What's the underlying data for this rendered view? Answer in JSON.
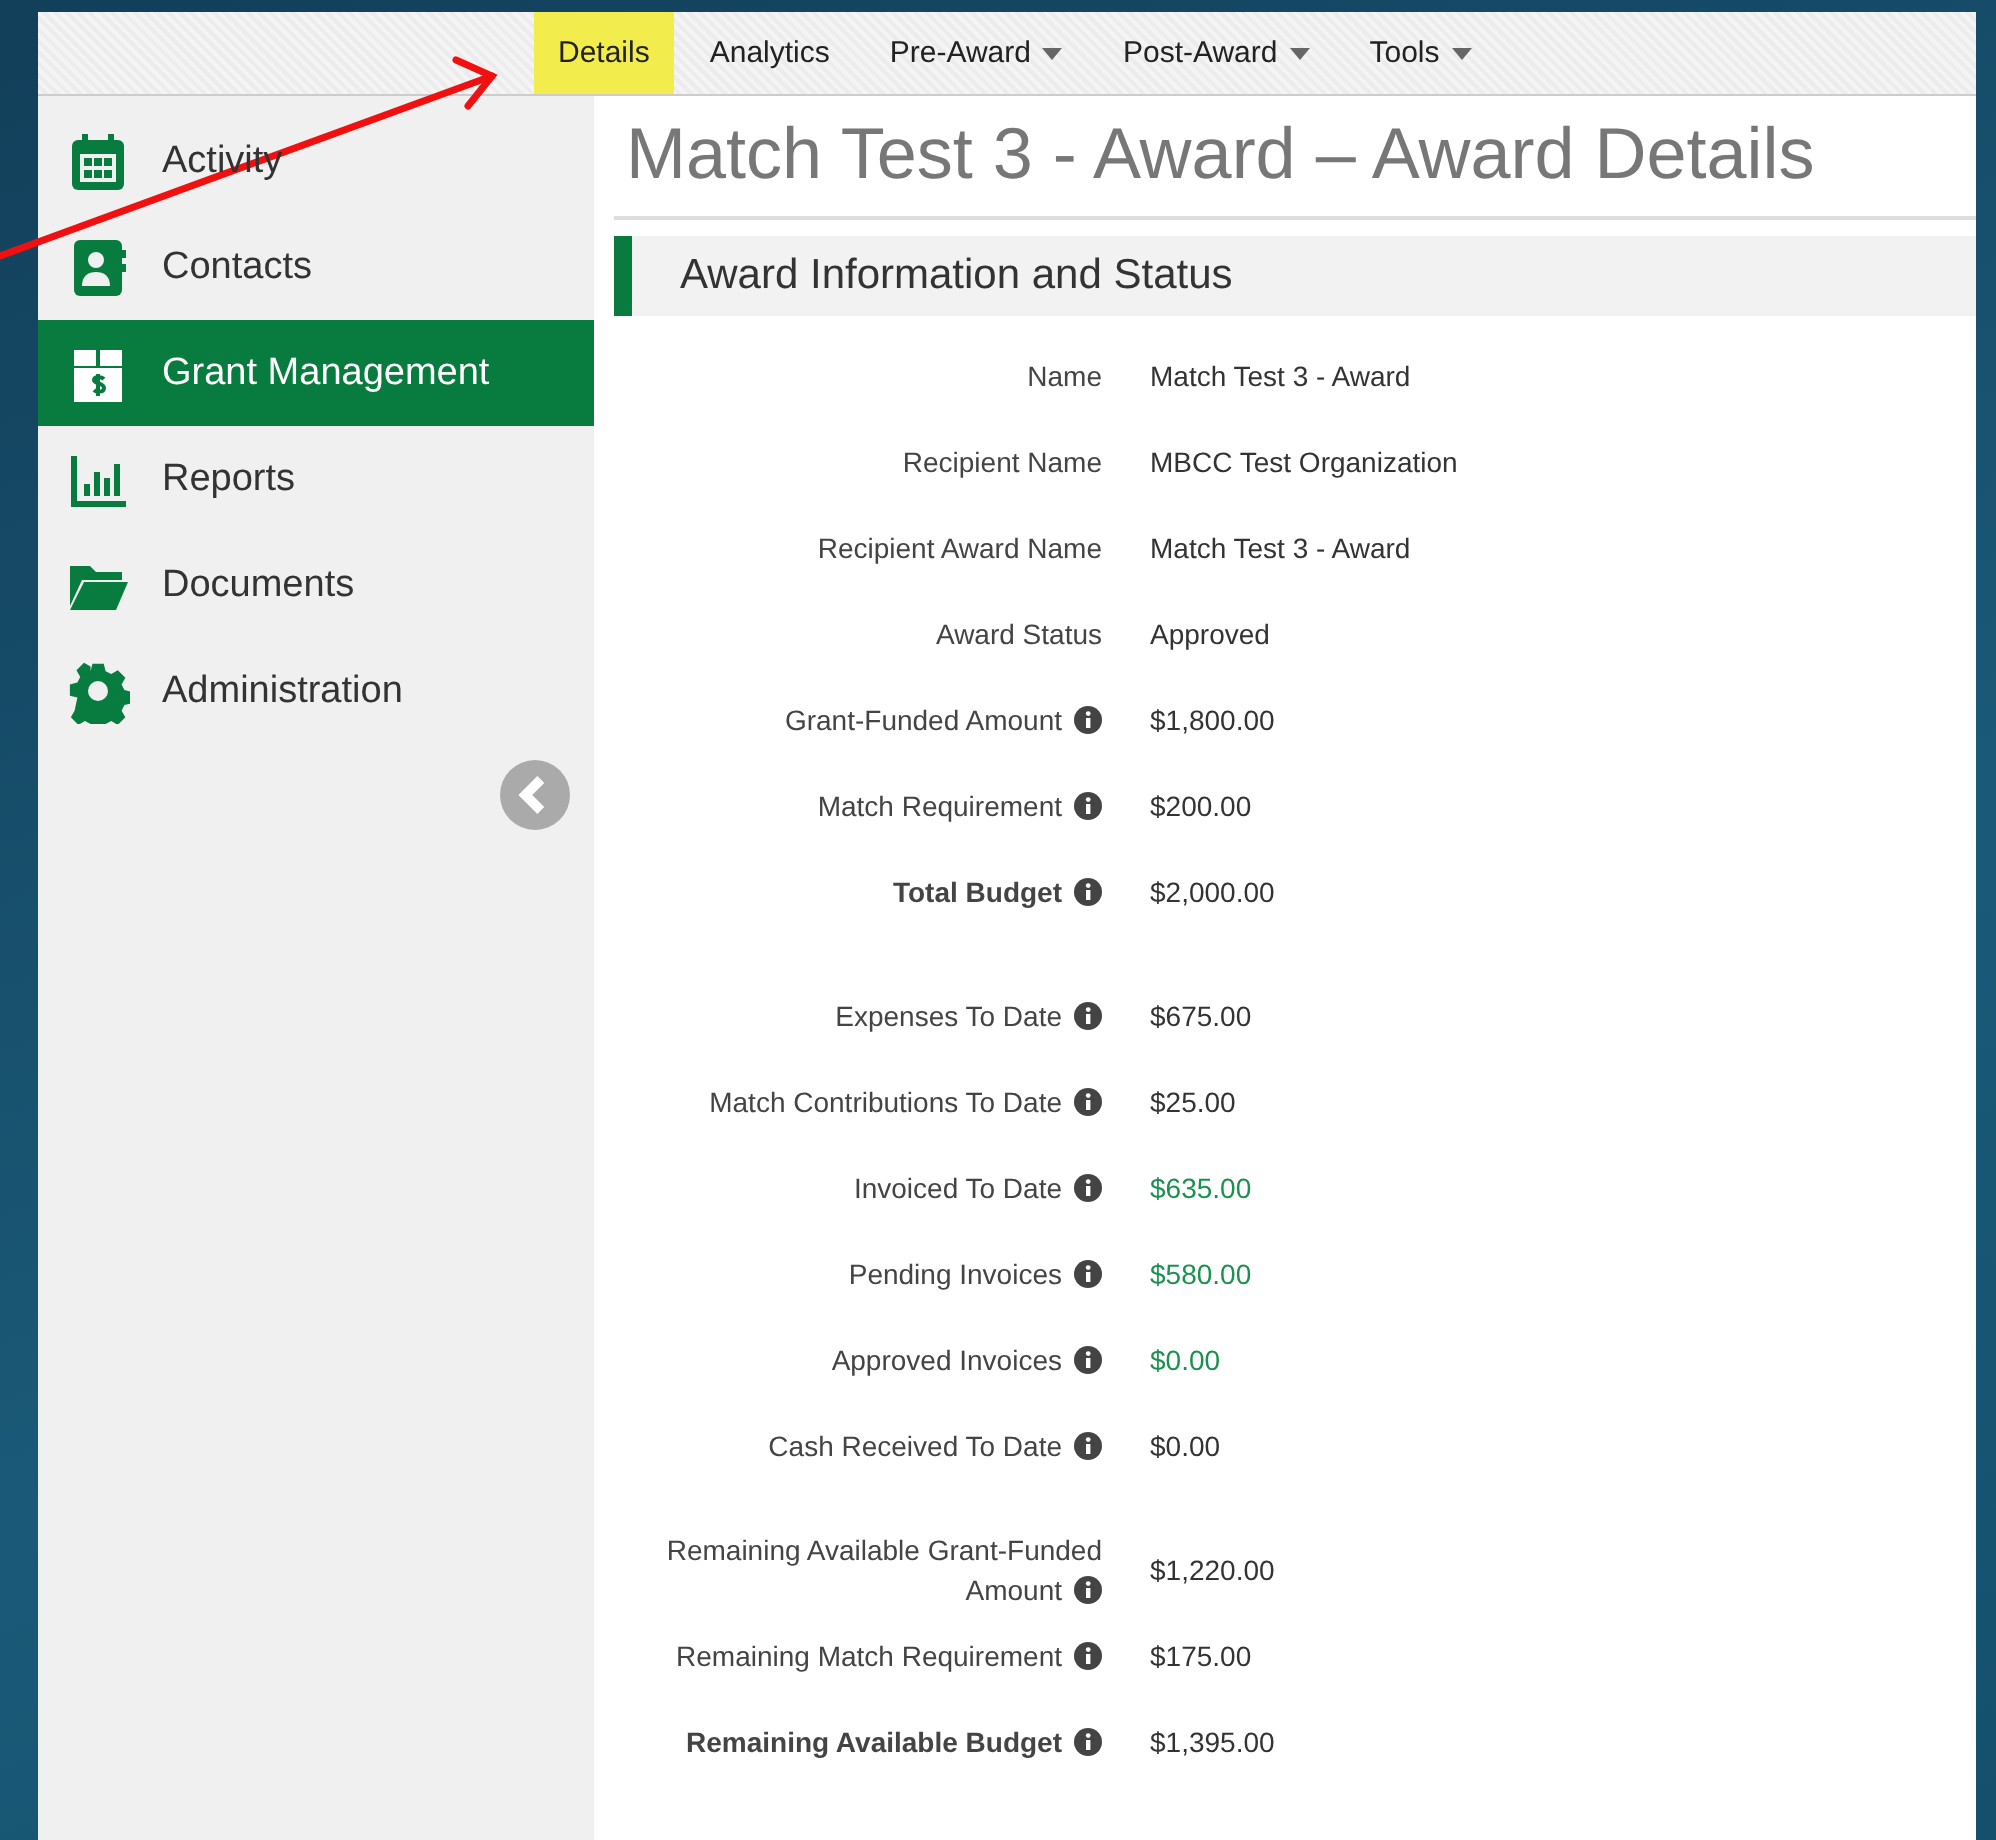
{
  "top_nav": [
    {
      "label": "Details",
      "selected": true,
      "dropdown": false
    },
    {
      "label": "Analytics",
      "selected": false,
      "dropdown": false
    },
    {
      "label": "Pre-Award",
      "selected": false,
      "dropdown": true
    },
    {
      "label": "Post-Award",
      "selected": false,
      "dropdown": true
    },
    {
      "label": "Tools",
      "selected": false,
      "dropdown": true
    }
  ],
  "sidebar": {
    "items": [
      {
        "label": "Activity",
        "kind": "calendar",
        "selected": false
      },
      {
        "label": "Contacts",
        "kind": "contact",
        "selected": false
      },
      {
        "label": "Grant Management",
        "kind": "box",
        "selected": true
      },
      {
        "label": "Reports",
        "kind": "chart",
        "selected": false
      },
      {
        "label": "Documents",
        "kind": "folder",
        "selected": false
      },
      {
        "label": "Administration",
        "kind": "gear",
        "selected": false
      }
    ]
  },
  "page_title": "Match Test 3 - Award – Award Details",
  "section": {
    "title": "Award Information and Status",
    "groups": [
      [
        {
          "label": "Name",
          "value": "Match Test 3 - Award",
          "info": false,
          "bold": false,
          "highlight": false
        },
        {
          "label": "Recipient Name",
          "value": "MBCC Test Organization",
          "info": false,
          "bold": false,
          "highlight": false
        },
        {
          "label": "Recipient Award Name",
          "value": "Match Test 3 - Award",
          "info": false,
          "bold": false,
          "highlight": false
        },
        {
          "label": "Award Status",
          "value": "Approved",
          "info": false,
          "bold": false,
          "highlight": false
        },
        {
          "label": "Grant-Funded Amount",
          "value": "$1,800.00",
          "info": true,
          "bold": false,
          "highlight": false
        },
        {
          "label": "Match Requirement",
          "value": "$200.00",
          "info": true,
          "bold": false,
          "highlight": false
        },
        {
          "label": "Total Budget",
          "value": "$2,000.00",
          "info": true,
          "bold": true,
          "highlight": false
        }
      ],
      [
        {
          "label": "Expenses To Date",
          "value": "$675.00",
          "info": true,
          "bold": false,
          "highlight": false
        },
        {
          "label": "Match Contributions To Date",
          "value": "$25.00",
          "info": true,
          "bold": false,
          "highlight": false
        },
        {
          "label": "Invoiced To Date",
          "value": "$635.00",
          "info": true,
          "bold": false,
          "highlight": true
        },
        {
          "label": "Pending Invoices",
          "value": "$580.00",
          "info": true,
          "bold": false,
          "highlight": true
        },
        {
          "label": "Approved Invoices",
          "value": "$0.00",
          "info": true,
          "bold": false,
          "highlight": true
        },
        {
          "label": "Cash Received To Date",
          "value": "$0.00",
          "info": true,
          "bold": false,
          "highlight": false
        }
      ],
      [
        {
          "label": "Remaining Available Grant-Funded Amount",
          "value": "$1,220.00",
          "info": true,
          "bold": false,
          "highlight": false
        },
        {
          "label": "Remaining Match Requirement",
          "value": "$175.00",
          "info": true,
          "bold": false,
          "highlight": false
        },
        {
          "label": "Remaining Available Budget",
          "value": "$1,395.00",
          "info": true,
          "bold": true,
          "highlight": false
        }
      ]
    ]
  }
}
